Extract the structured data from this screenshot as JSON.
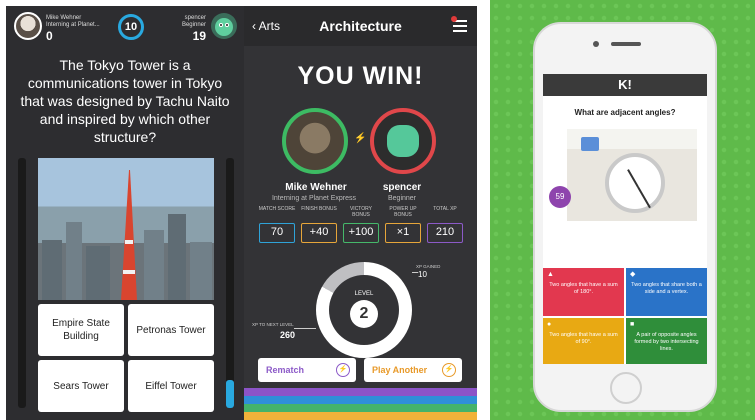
{
  "screen_question": {
    "player_name": "Mike Wehner",
    "player_sub": "Interning at Planet...",
    "player_score": "0",
    "timer": "10",
    "opponent_name": "spencer",
    "opponent_sub": "Beginner",
    "opponent_score": "19",
    "question": "The Tokyo Tower is a communications tower in Tokyo that was designed by Tachu Naito and inspired by which other structure?",
    "answers": [
      "Empire State Building",
      "Petronas Tower",
      "Sears Tower",
      "Eiffel Tower"
    ]
  },
  "screen_result": {
    "back_label": "Arts",
    "title": "Architecture",
    "headline": "YOU WIN!",
    "player_name": "Mike Wehner",
    "player_sub": "Interning at Planet Express",
    "opponent_name": "spencer",
    "opponent_sub": "Beginner",
    "stat_labels": [
      "MATCH SCORE",
      "FINISH BONUS",
      "VICTORY BONUS",
      "POWER UP BONUS",
      "TOTAL XP"
    ],
    "stat_values": [
      "70",
      "+40",
      "+100",
      "×1",
      "210"
    ],
    "stat_colors": [
      "#2fa3d8",
      "#e7a63a",
      "#45b86a",
      "#e7a63a",
      "#8c5ac8"
    ],
    "level_label": "LEVEL",
    "level": "2",
    "xp_gained_label": "XP GAINED",
    "xp_gained": "10",
    "xp_next_label": "XP TO NEXT LEVEL",
    "xp_next": "260",
    "level_progress": 0.83,
    "rematch_label": "Rematch",
    "play_another_label": "Play Another"
  },
  "screen_kahoot": {
    "logo": "K!",
    "question": "What are adjacent angles?",
    "timer": "59",
    "answers": [
      {
        "text": "Two angles that have a sum of 180°.",
        "color": "#e2384f",
        "symbol": "▲"
      },
      {
        "text": "Two angles that share both a side and a vertex.",
        "color": "#2a73c8",
        "symbol": "◆"
      },
      {
        "text": "Two angles that have a sum of 90°.",
        "color": "#e8a913",
        "symbol": "●"
      },
      {
        "text": "A pair of opposite angles formed by two intersecting lines.",
        "color": "#2f8e3a",
        "symbol": "■"
      }
    ]
  }
}
